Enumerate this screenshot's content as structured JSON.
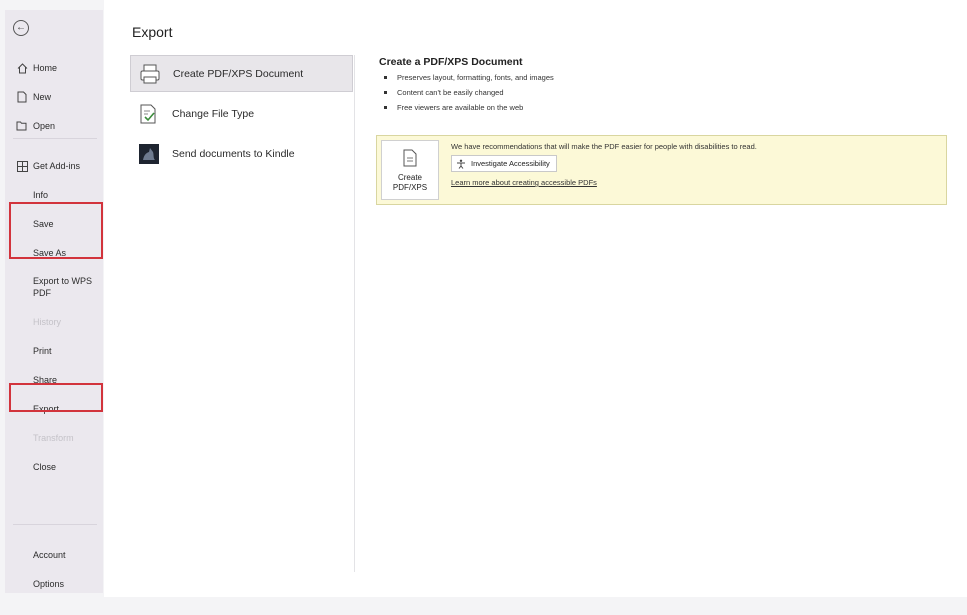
{
  "sidebar": {
    "back_icon": "arrow-left-circle-icon",
    "items": [
      {
        "label": "Home",
        "icon": "home-icon"
      },
      {
        "label": "New",
        "icon": "new-document-icon"
      },
      {
        "label": "Open",
        "icon": "folder-open-icon"
      },
      {
        "label": "Get Add-ins",
        "icon": "grid-icon"
      },
      {
        "label": "Info"
      },
      {
        "label": "Save"
      },
      {
        "label": "Save As"
      },
      {
        "label": "Export to WPS PDF"
      },
      {
        "label": "History",
        "disabled": true
      },
      {
        "label": "Print"
      },
      {
        "label": "Share"
      },
      {
        "label": "Export"
      },
      {
        "label": "Transform",
        "disabled": true
      },
      {
        "label": "Close"
      },
      {
        "label": "Account"
      },
      {
        "label": "Options"
      }
    ]
  },
  "annotation": {
    "highlight_color": "#d2333c"
  },
  "main": {
    "title": "Export",
    "options": [
      {
        "label": "Create PDF/XPS Document",
        "icon": "pdf-document-icon",
        "selected": true
      },
      {
        "label": "Change File Type",
        "icon": "change-file-type-icon"
      },
      {
        "label": "Send documents to Kindle",
        "icon": "kindle-icon"
      }
    ],
    "detail": {
      "title": "Create a PDF/XPS Document",
      "bullets": [
        "Preserves layout, formatting, fonts, and images",
        "Content can't be easily changed",
        "Free viewers are available on the web"
      ],
      "create_button": {
        "line1": "Create",
        "line2": "PDF/XPS",
        "icon": "pdf-create-icon"
      },
      "recommendation_text": "We have recommendations that will make the PDF easier for people with disabilities to read.",
      "investigate_button": {
        "label": "Investigate Accessibility",
        "icon": "accessibility-icon"
      },
      "learn_link": "Learn more about creating accessible PDFs"
    }
  }
}
